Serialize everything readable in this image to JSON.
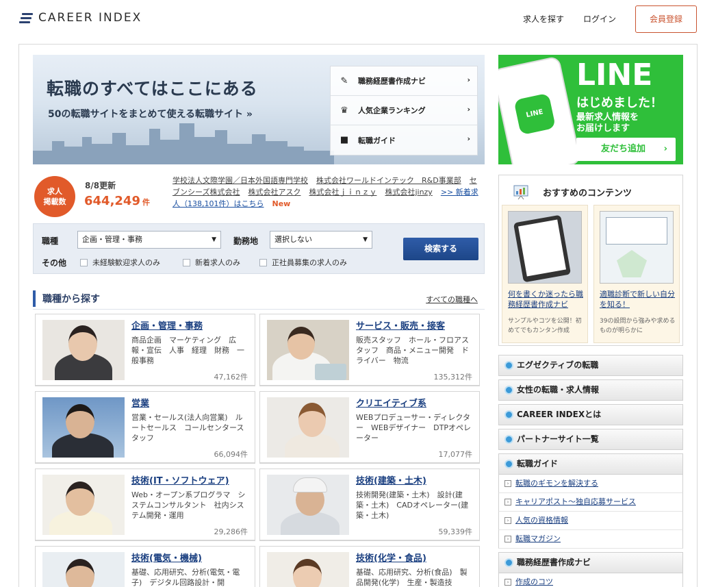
{
  "header": {
    "logo_text": "CAREER INDEX",
    "nav": {
      "find_jobs": "求人を探す",
      "login": "ログイン",
      "register": "会員登録"
    }
  },
  "hero": {
    "title": "転職のすべてはここにある",
    "subtitle": "50の転職サイトをまとめて使える転職サイト »",
    "menu": [
      {
        "label": "職務経歴書作成ナビ",
        "icon": "pencil-icon"
      },
      {
        "label": "人気企業ランキング",
        "icon": "trophy-icon"
      },
      {
        "label": "転職ガイド",
        "icon": "book-icon"
      }
    ]
  },
  "stats": {
    "badge": [
      "求人",
      "掲載数"
    ],
    "updated": "8/8更新",
    "count": "644,249",
    "unit": "件",
    "companies": [
      "学校法人文際学園／日本外国語専門学校",
      "株式会社ワールドインテック　R&D事業部",
      "セブンシーズ株式会社",
      "株式会社アスク",
      "株式会社ｊｉｎｚｙ",
      "株式会社jinzy"
    ],
    "new_link": ">> 新着求人（138,101件）はこちら",
    "new_tag": "New"
  },
  "search": {
    "job_label": "職種",
    "job_value": "企画・管理・事務",
    "location_label": "勤務地",
    "location_value": "選択しない",
    "other_label": "その他",
    "checks": [
      "未経験歓迎求人のみ",
      "新着求人のみ",
      "正社員募集の求人のみ"
    ],
    "button": "検索する"
  },
  "section": {
    "title": "職種から探す",
    "link": "すべての職種へ"
  },
  "categories": [
    {
      "name": "企画・管理・事務",
      "desc": "商品企画　マーケティング　広報・宣伝　人事　経理　財務　一般事務",
      "count": "47,162件"
    },
    {
      "name": "サービス・販売・接客",
      "desc": "販売スタッフ　ホール・フロアスタッフ　商品・メニュー開発　ドライバー　物流",
      "count": "135,312件"
    },
    {
      "name": "営業",
      "desc": "営業・セールス(法人向営業)　ルートセールス　コールセンタースタッフ",
      "count": "66,094件"
    },
    {
      "name": "クリエイティブ系",
      "desc": "WEBプロデューサー・ディレクター　WEBデザイナー　DTPオペレーター",
      "count": "17,077件"
    },
    {
      "name": "技術(IT・ソフトウェア)",
      "desc": "Web・オープン系プログラマ　システムコンサルタント　社内システム開発・運用",
      "count": "29,286件"
    },
    {
      "name": "技術(建築・土木)",
      "desc": "技術開発(建築・土木)　設計(建築・土木)　CADオペレーター(建築・土木)",
      "count": "59,339件"
    },
    {
      "name": "技術(電気・機械)",
      "desc": "基礎、応用研究、分析(電気・電子)　デジタル回路設計・開",
      "count": ""
    },
    {
      "name": "技術(化学・食品)",
      "desc": "基礎、応用研究、分析(食品)　製品開発(化学)　生産・製造技",
      "count": ""
    }
  ],
  "line": {
    "big": "LINE",
    "sub1": "はじめました！",
    "sub2": "最新求人情報を",
    "sub3": "お届けします",
    "button": "友だち追加",
    "icon_text": "LINE"
  },
  "reco": {
    "title": "おすすめのコンテンツ",
    "items": [
      {
        "link": "何を書くか迷ったら職務経歴書作成ナビ",
        "note": "サンプルやコツを公開！初めてでもカンタン作成"
      },
      {
        "link": "適職診断で新しい自分を知る！",
        "note": "39の設問から強みや求めるものが明らかに"
      }
    ]
  },
  "side_menu": [
    "エグゼクティブの転職",
    "女性の転職・求人情報",
    "CAREER INDEXとは",
    "パートナーサイト一覧",
    "転職ガイド",
    "職務経歴書作成ナビ"
  ],
  "guide_links": [
    "転職のギモンを解決する",
    "キャリアポスト〜独自応募サービス",
    "人気の資格情報",
    "転職マガジン"
  ],
  "navi_links": [
    "作成のコツ"
  ],
  "colors": {
    "accent": "#e15a2a",
    "primary": "#2f5ca8",
    "line_green": "#2fbf3a"
  }
}
